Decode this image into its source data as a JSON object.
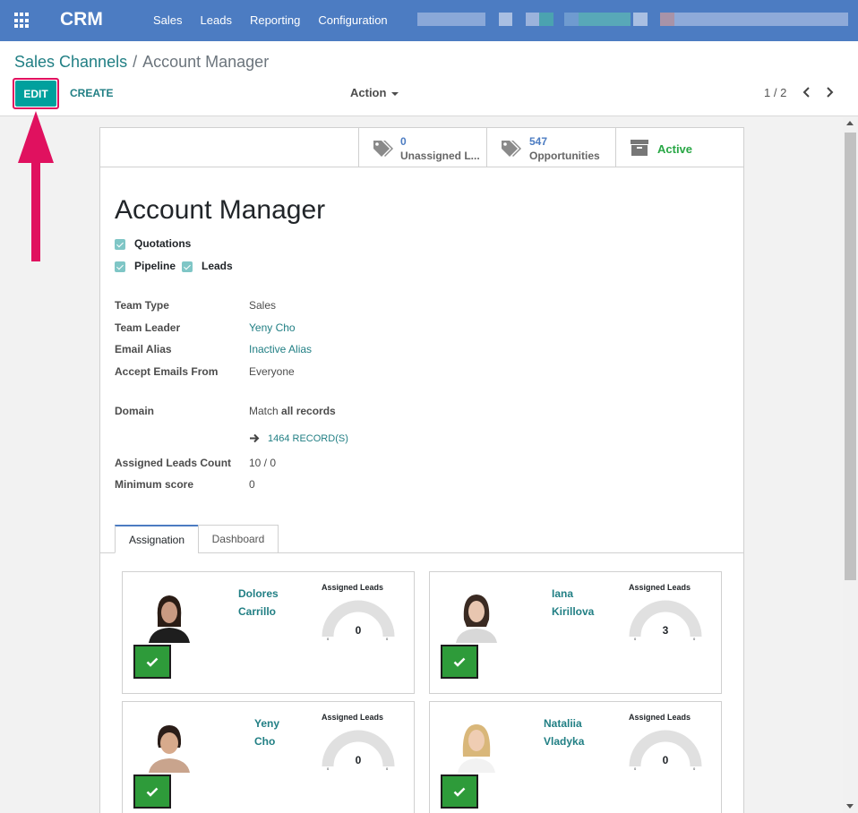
{
  "navbar": {
    "brand": "CRM",
    "menu": [
      "Sales",
      "Leads",
      "Reporting",
      "Configuration"
    ]
  },
  "breadcrumb": {
    "parent": "Sales Channels",
    "separator": "/",
    "current": "Account Manager"
  },
  "toolbar": {
    "edit_label": "EDIT",
    "create_label": "CREATE",
    "action_label": "Action",
    "pager": "1 / 2"
  },
  "stat_buttons": [
    {
      "value": "0",
      "label": "Unassigned L...",
      "icon": "tags-icon"
    },
    {
      "value": "547",
      "label": "Opportunities",
      "icon": "tags-icon"
    },
    {
      "value": "",
      "label": "Active",
      "icon": "archive-icon"
    }
  ],
  "record": {
    "title": "Account Manager",
    "checkboxes": [
      {
        "label": "Quotations",
        "checked": true
      },
      {
        "label": "Pipeline",
        "checked": true
      },
      {
        "label": "Leads",
        "checked": true
      }
    ],
    "fields": {
      "team_type": {
        "label": "Team Type",
        "value": "Sales"
      },
      "team_leader": {
        "label": "Team Leader",
        "value": "Yeny Cho"
      },
      "email_alias": {
        "label": "Email Alias",
        "value": "Inactive Alias"
      },
      "accept_emails": {
        "label": "Accept Emails From",
        "value": "Everyone"
      },
      "domain": {
        "label": "Domain",
        "value_prefix": "Match",
        "value_bold": "all records"
      },
      "records_link": "1464 RECORD(S)",
      "assigned_leads": {
        "label": "Assigned Leads Count",
        "value": "10 / 0"
      },
      "min_score": {
        "label": "Minimum score",
        "value": "0"
      }
    }
  },
  "tabs": [
    "Assignation",
    "Dashboard"
  ],
  "members": [
    {
      "first": "Dolores",
      "last": "Carrillo",
      "gauge_title": "Assigned Leads",
      "gauge_value": "0",
      "gauge_min": "0",
      "gauge_max": "0"
    },
    {
      "first": "Iana",
      "last": "Kirillova",
      "gauge_title": "Assigned Leads",
      "gauge_value": "3",
      "gauge_min": "0",
      "gauge_max": "0"
    },
    {
      "first": "Yeny",
      "last": "Cho",
      "gauge_title": "Assigned Leads",
      "gauge_value": "0",
      "gauge_min": "0",
      "gauge_max": "0"
    },
    {
      "first": "Nataliia",
      "last": "Vladyka",
      "gauge_title": "Assigned Leads",
      "gauge_value": "0",
      "gauge_min": "0",
      "gauge_max": "0"
    }
  ],
  "colors": {
    "navbar": "#4c7cc2",
    "primary": "#00a09d",
    "link": "#217f84",
    "annotation_arrow": "#e0115f",
    "check_button": "#2e9b3a"
  }
}
